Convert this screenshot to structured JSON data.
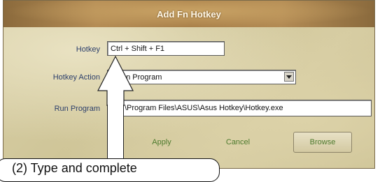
{
  "dialog": {
    "title": "Add Fn Hotkey",
    "hotkey_label": "Hotkey",
    "hotkey_value": "Ctrl + Shift + F1",
    "action_label": "Hotkey Action",
    "action_value": "Run Program",
    "action_value_visible": "un Program",
    "program_label": "Run Program",
    "program_value": "C:\\Program Files\\ASUS\\Asus Hotkey\\Hotkey.exe",
    "program_value_visible": "\\Program Files\\ASUS\\Asus Hotkey\\Hotkey.exe",
    "apply_label": "Apply",
    "cancel_label": "Cancel",
    "browse_label": "Browse"
  },
  "annotation": {
    "callout_text": "(2) Type and complete"
  },
  "colors": {
    "label_text": "#2c3f6b",
    "button_text": "#4d7a2e",
    "title_text": "#fff7e6"
  }
}
